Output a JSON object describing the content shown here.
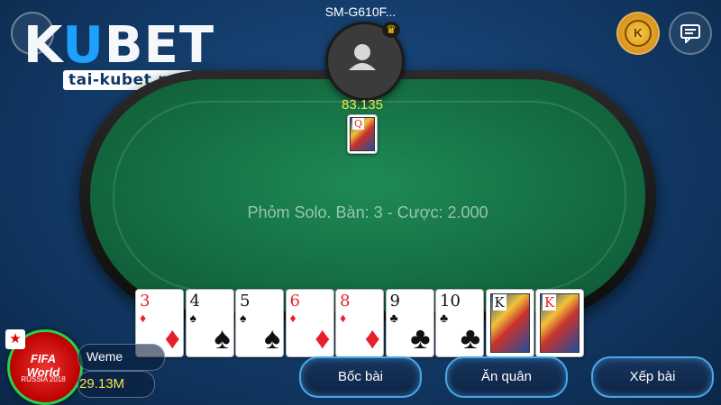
{
  "logo": {
    "k": "K",
    "u": "U",
    "bet": "BET",
    "url": "tai-kubet.net"
  },
  "opponent": {
    "name": "SM-G610F...",
    "money": "83.135",
    "card": {
      "rank": "Q",
      "color": "red"
    }
  },
  "table": {
    "info": "Phỏm Solo. Bàn: 3 - Cược: 2.000"
  },
  "hand": [
    {
      "rank": "3",
      "suit": "♦",
      "color": "red"
    },
    {
      "rank": "4",
      "suit": "♠",
      "color": "black"
    },
    {
      "rank": "5",
      "suit": "♠",
      "color": "black"
    },
    {
      "rank": "6",
      "suit": "♦",
      "color": "red"
    },
    {
      "rank": "8",
      "suit": "♦",
      "color": "red"
    },
    {
      "rank": "9",
      "suit": "♣",
      "color": "black"
    },
    {
      "rank": "10",
      "suit": "♣",
      "color": "black"
    },
    {
      "rank": "K",
      "suit": "face",
      "color": "black"
    },
    {
      "rank": "K",
      "suit": "face",
      "color": "red"
    }
  ],
  "player": {
    "name": "Weme",
    "money": "29.13M",
    "avatar_title": "FIFA World",
    "avatar_sub": "RUSSIA 2018"
  },
  "actions": {
    "draw": "Bốc bài",
    "eat": "Ăn quân",
    "arrange": "Xếp bài"
  },
  "top_right": {
    "coin_letter": "K",
    "chat_icon": "chat-icon"
  },
  "colors": {
    "felt": "#146e42",
    "button_border": "#4aa7e8",
    "money": "#f3e54b"
  }
}
